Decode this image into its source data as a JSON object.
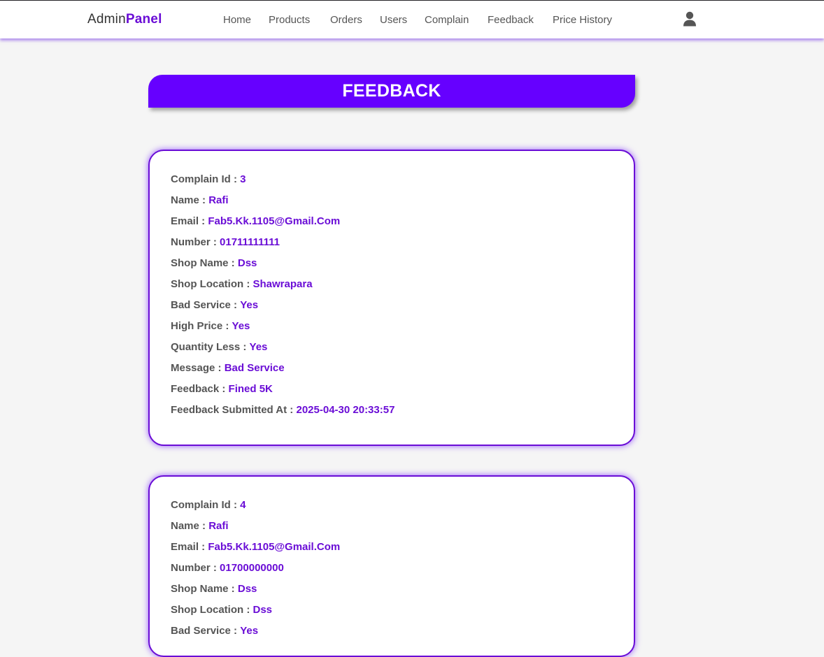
{
  "brand": {
    "first": "Admin",
    "second": "Panel"
  },
  "nav": [
    {
      "label": "Home"
    },
    {
      "label": "Products"
    },
    {
      "label": "Orders"
    },
    {
      "label": "Users"
    },
    {
      "label": "Complain"
    },
    {
      "label": "Feedback"
    },
    {
      "label": "Price History"
    }
  ],
  "user_icon": "user-icon",
  "page_title": "FEEDBACK",
  "colors": {
    "accent": "#6a0dd6",
    "banner": "#6600ff",
    "background": "#f5f5f5"
  },
  "feedbacks": [
    {
      "rows": [
        {
          "label": "Complain Id :",
          "value": "3"
        },
        {
          "label": "Name :",
          "value": "Rafi"
        },
        {
          "label": "Email :",
          "value": "Fab5.Kk.1105@Gmail.Com"
        },
        {
          "label": "Number :",
          "value": "01711111111"
        },
        {
          "label": "Shop Name :",
          "value": "Dss"
        },
        {
          "label": "Shop Location :",
          "value": "Shawrapara"
        },
        {
          "label": "Bad Service :",
          "value": "Yes"
        },
        {
          "label": "High Price :",
          "value": "Yes"
        },
        {
          "label": "Quantity Less :",
          "value": "Yes"
        },
        {
          "label": "Message :",
          "value": "Bad Service"
        },
        {
          "label": "Feedback :",
          "value": "Fined 5K"
        },
        {
          "label": "Feedback Submitted At :",
          "value": "2025-04-30 20:33:57"
        }
      ]
    },
    {
      "rows": [
        {
          "label": "Complain Id :",
          "value": "4"
        },
        {
          "label": "Name :",
          "value": "Rafi"
        },
        {
          "label": "Email :",
          "value": "Fab5.Kk.1105@Gmail.Com"
        },
        {
          "label": "Number :",
          "value": "01700000000"
        },
        {
          "label": "Shop Name :",
          "value": "Dss"
        },
        {
          "label": "Shop Location :",
          "value": "Dss"
        },
        {
          "label": "Bad Service :",
          "value": "Yes"
        }
      ]
    }
  ]
}
